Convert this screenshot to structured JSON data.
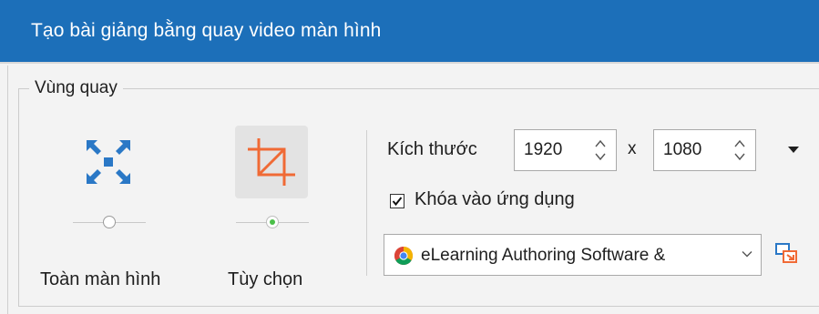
{
  "window": {
    "title": "Tạo bài giảng bằng quay video màn hình"
  },
  "capture_area": {
    "legend": "Vùng quay",
    "modes": [
      {
        "label": "Toàn màn hình",
        "icon": "fullscreen-arrows-icon",
        "selected": false
      },
      {
        "label": "Tùy chọn",
        "icon": "crop-icon",
        "selected": true
      }
    ],
    "size": {
      "label": "Kích thước",
      "width": "1920",
      "separator": "x",
      "height": "1080"
    },
    "lock_app": {
      "label": "Khóa vào ứng dụng",
      "checked": true
    },
    "app_select": {
      "value": "eLearning Authoring Software &",
      "icon": "chrome-icon"
    }
  },
  "colors": {
    "title_bar": "#1c6fb9",
    "accent_blue": "#2a78c6",
    "crop_orange": "#f06a35",
    "selected_radio": "#4cc04a"
  }
}
